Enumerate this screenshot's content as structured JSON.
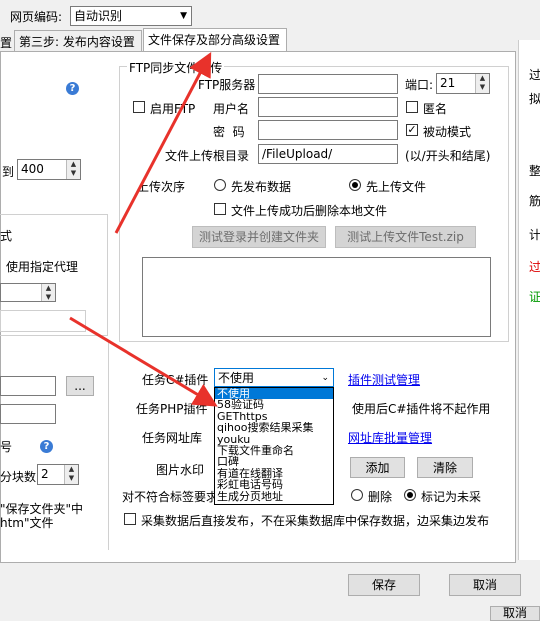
{
  "window": {
    "encoding_label": "网页编码:",
    "encoding_value": "自动识别"
  },
  "tabs": [
    {
      "label": "第三步: 发布内容设置"
    },
    {
      "label": "文件保存及部分高级设置"
    }
  ],
  "tab_prefix": "置",
  "left": {
    "to_label": "到",
    "to_value": "400",
    "frag_label": "式",
    "proxy_label": "使用指定代理",
    "ellipsis_btn": "...",
    "frag1": "号",
    "blocks_label": "分块数",
    "blocks_value": "2",
    "save_text1": "\"保存文件夹\"中",
    "save_text2": "htm\"文件"
  },
  "ftp": {
    "legend": "FTP同步文件上传",
    "server_label": "FTP服务器",
    "port_label": "端口:",
    "port_value": "21",
    "enable_label": "启用FTP",
    "user_label": "用户名",
    "anon_label": "匿名",
    "pwd_label": "密  码",
    "passive_label": "被动模式",
    "root_label": "文件上传根目录",
    "root_value": "/FileUpload/",
    "root_hint": "(以/开头和结尾)",
    "order_label": "上传次序",
    "order_opt1": "先发布数据",
    "order_opt2": "先上传文件",
    "delete_label": "文件上传成功后删除本地文件",
    "test_login_btn": "测试登录并创建文件夹",
    "test_upload_btn": "测试上传文件Test.zip"
  },
  "plugin": {
    "label": "任务C#插件",
    "value": "不使用",
    "test_link": "插件测试管理",
    "php_label": "任务PHP插件",
    "php_note": "使用后C#插件将不起作用",
    "url_label": "任务网址库",
    "url_link": "网址库批量管理",
    "watermark_label": "图片水印",
    "add_btn": "添加",
    "clear_btn": "清除",
    "nonmatch_label": "对不符合标签要求",
    "opt_delete": "删除",
    "opt_mark": "标记为未采",
    "direct_publish": "采集数据后直接发布，不在采集数据库中保存数据，边采集边发布"
  },
  "dropdown_options": [
    "不使用",
    "58验证码",
    "GEThttps",
    "qihoo搜索结果采集",
    "youku",
    "下载文件重命名",
    "口碑",
    "有道在线翻译",
    "彩虹电话号码",
    "生成分页地址"
  ],
  "footer": {
    "save_btn": "保存",
    "cancel_btn": "取消",
    "cancel_btn2": "取消"
  },
  "right_edge": [
    "过",
    "拟",
    "整",
    "筋",
    "计",
    "过",
    "证"
  ],
  "colors": {
    "accent": "#0078d7",
    "arrow": "#e8322b",
    "link": "#0000ee"
  }
}
